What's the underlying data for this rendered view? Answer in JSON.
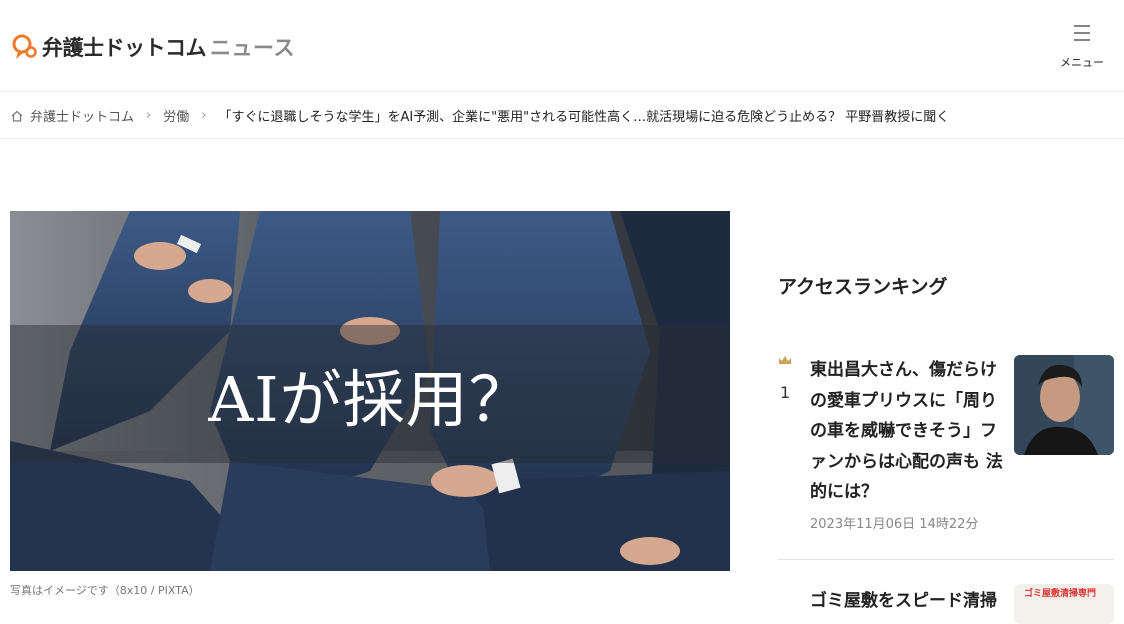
{
  "header": {
    "logo_text": "弁護士ドットコム",
    "logo_news": "ニュース",
    "menu_label": "メニュー"
  },
  "breadcrumb": {
    "home": "弁護士ドットコム",
    "category": "労働",
    "current": "「すぐに退職しそうな学生」をAI予測、企業に\"悪用\"される可能性高く…就活現場に迫る危険どう止める？ 平野晋教授に聞く"
  },
  "hero": {
    "overlay_text": "AIが採用？",
    "caption": "写真はイメージです（8x10 / PIXTA）"
  },
  "ranking": {
    "title": "アクセスランキング",
    "items": [
      {
        "rank": "1",
        "headline": "東出昌大さん、傷だらけの愛車プリウスに「周りの車を威嚇できそう」ファンからは心配の声も 法的には？",
        "date": "2023年11月06日 14時22分"
      },
      {
        "headline": "ゴミ屋敷をスピード清掃",
        "thumb_text": "ゴミ屋敷清掃専門"
      }
    ]
  },
  "colors": {
    "brand_orange": "#f07a2a",
    "text_dark": "#222222",
    "text_muted": "#888888",
    "crown_gold": "#c9a35a"
  },
  "icons": {
    "logo": "balloon-logo-icon",
    "menu": "hamburger-icon",
    "home": "home-icon",
    "separator": "chevron-right-icon",
    "rank": "crown-icon"
  }
}
